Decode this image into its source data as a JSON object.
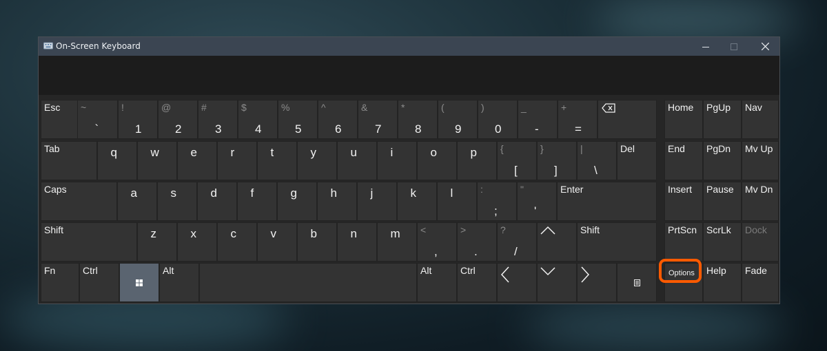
{
  "window": {
    "title": "On-Screen Keyboard"
  },
  "colors": {
    "highlight": "#ff5a00",
    "key_bg": "#333333",
    "title_bar": "#3b4552"
  },
  "rows": [
    [
      {
        "label": "Esc"
      },
      {
        "shift": "~",
        "base": "`"
      },
      {
        "shift": "!",
        "base": "1"
      },
      {
        "shift": "@",
        "base": "2"
      },
      {
        "shift": "#",
        "base": "3"
      },
      {
        "shift": "$",
        "base": "4"
      },
      {
        "shift": "%",
        "base": "5"
      },
      {
        "shift": "^",
        "base": "6"
      },
      {
        "shift": "&",
        "base": "7"
      },
      {
        "shift": "*",
        "base": "8"
      },
      {
        "shift": "(",
        "base": "9"
      },
      {
        "shift": ")",
        "base": "0"
      },
      {
        "shift": "_",
        "base": "-"
      },
      {
        "shift": "+",
        "base": "="
      },
      {
        "icon": "backspace-icon"
      },
      {
        "label": "Home"
      },
      {
        "label": "PgUp"
      },
      {
        "label": "Nav"
      }
    ],
    [
      {
        "label": "Tab"
      },
      {
        "char": "q"
      },
      {
        "char": "w"
      },
      {
        "char": "e"
      },
      {
        "char": "r"
      },
      {
        "char": "t"
      },
      {
        "char": "y"
      },
      {
        "char": "u"
      },
      {
        "char": "i"
      },
      {
        "char": "o"
      },
      {
        "char": "p"
      },
      {
        "shift": "{",
        "base": "["
      },
      {
        "shift": "}",
        "base": "]"
      },
      {
        "shift": "|",
        "base": "\\"
      },
      {
        "label": "Del"
      },
      {
        "label": "End"
      },
      {
        "label": "PgDn"
      },
      {
        "label": "Mv Up"
      }
    ],
    [
      {
        "label": "Caps"
      },
      {
        "char": "a"
      },
      {
        "char": "s"
      },
      {
        "char": "d"
      },
      {
        "char": "f"
      },
      {
        "char": "g"
      },
      {
        "char": "h"
      },
      {
        "char": "j"
      },
      {
        "char": "k"
      },
      {
        "char": "l"
      },
      {
        "shift": ":",
        "base": ";"
      },
      {
        "shift": "\"",
        "base": "'"
      },
      {
        "label": "Enter"
      },
      {
        "label": "Insert"
      },
      {
        "label": "Pause"
      },
      {
        "label": "Mv Dn"
      }
    ],
    [
      {
        "label": "Shift"
      },
      {
        "char": "z"
      },
      {
        "char": "x"
      },
      {
        "char": "c"
      },
      {
        "char": "v"
      },
      {
        "char": "b"
      },
      {
        "char": "n"
      },
      {
        "char": "m"
      },
      {
        "shift": "<",
        "base": ","
      },
      {
        "shift": ">",
        "base": "."
      },
      {
        "shift": "?",
        "base": "/"
      },
      {
        "icon": "arrow-up-icon"
      },
      {
        "label": "Shift"
      },
      {
        "label": "PrtScn"
      },
      {
        "label": "ScrLk"
      },
      {
        "label": "Dock",
        "disabled": true
      }
    ],
    [
      {
        "label": "Fn"
      },
      {
        "label": "Ctrl"
      },
      {
        "icon": "windows-logo-icon",
        "active": true
      },
      {
        "label": "Alt"
      },
      {
        "space": true
      },
      {
        "label": "Alt"
      },
      {
        "label": "Ctrl"
      },
      {
        "icon": "arrow-left-icon"
      },
      {
        "icon": "arrow-down-icon"
      },
      {
        "icon": "arrow-right-icon"
      },
      {
        "icon": "menu-key-icon"
      },
      {
        "label": "Options",
        "small": true,
        "highlighted": true
      },
      {
        "label": "Help"
      },
      {
        "label": "Fade"
      }
    ]
  ]
}
